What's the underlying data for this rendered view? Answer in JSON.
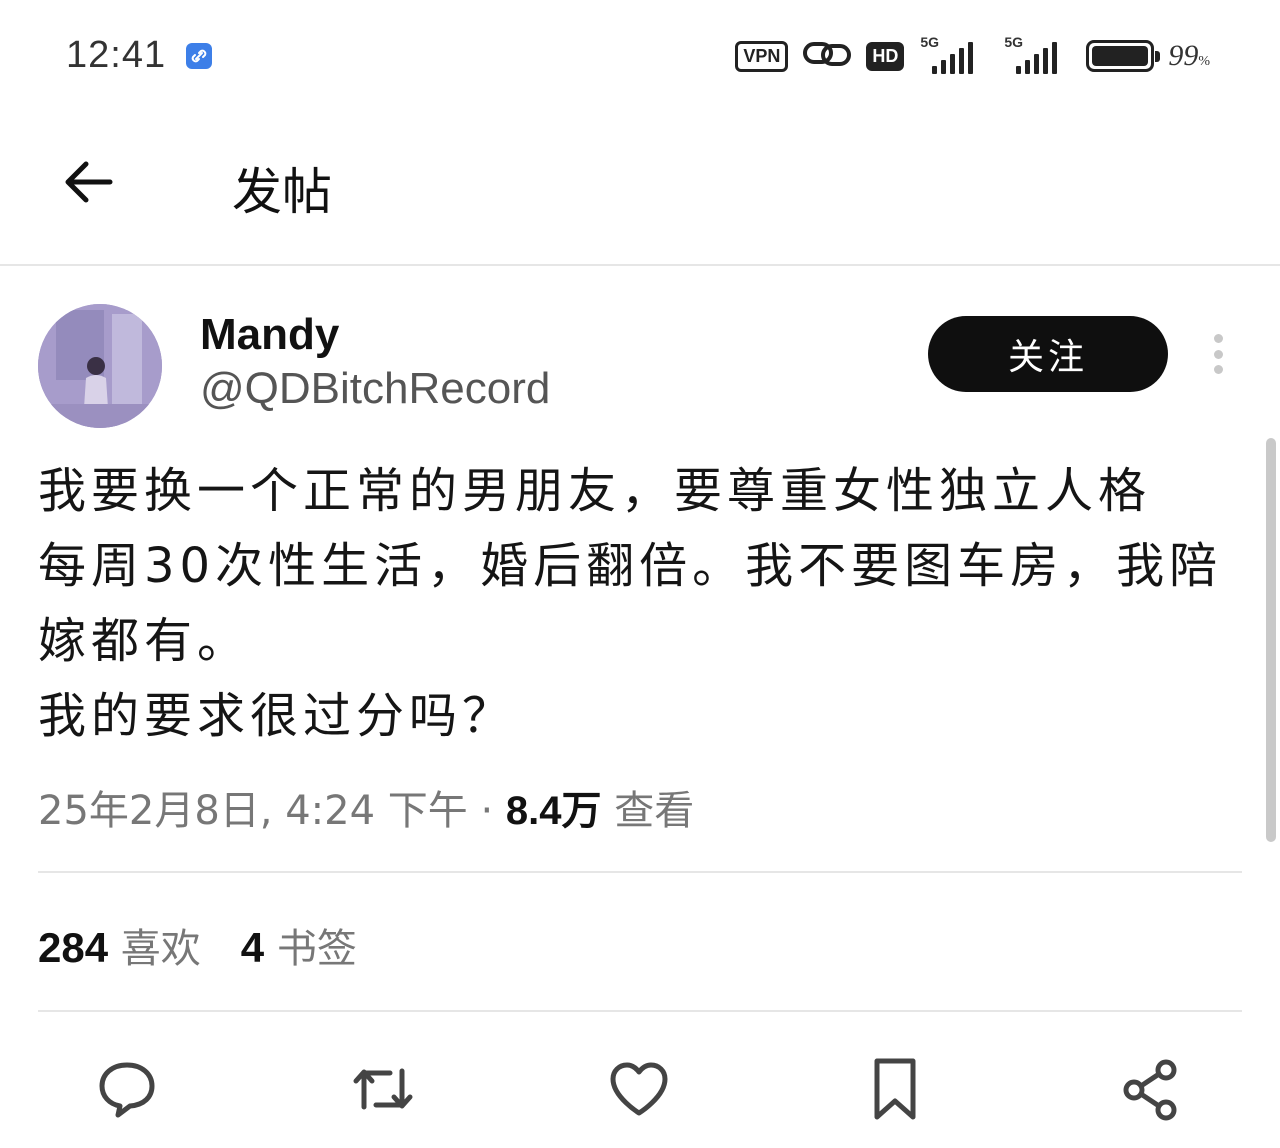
{
  "status_bar": {
    "time": "12:41",
    "vpn_label": "VPN",
    "hd_label": "HD",
    "signal_1_label": "5G",
    "signal_2_label": "5G",
    "battery_percent": "99",
    "battery_unit": "%",
    "battery_level": 0.99
  },
  "header": {
    "title": "发帖"
  },
  "author": {
    "name": "Mandy",
    "handle": "@QDBitchRecord",
    "follow_label": "关注"
  },
  "post": {
    "text": "我要换一个正常的男朋友，要尊重女性独立人格\n每周30次性生活，婚后翻倍。我不要图车房，我陪\n嫁都有。\n我的要求很过分吗？",
    "timestamp": "25年2月8日, 4:24 下午 · ",
    "views_count": "8.4万",
    "views_label": "查看"
  },
  "stats": {
    "likes_count": "284",
    "likes_label": "喜欢",
    "bookmarks_count": "4",
    "bookmarks_label": "书签"
  },
  "icons": {
    "back": "arrow-left-icon",
    "reply": "comment-icon",
    "repost": "repost-icon",
    "like": "heart-icon",
    "bookmark": "bookmark-icon",
    "share": "share-icon",
    "more": "more-vertical-icon"
  },
  "colors": {
    "follow_bg": "#0f0f0f",
    "text_primary": "#111111",
    "text_secondary": "#777777",
    "divider": "#e6e6e6",
    "link_badge": "#3d7fe8"
  }
}
